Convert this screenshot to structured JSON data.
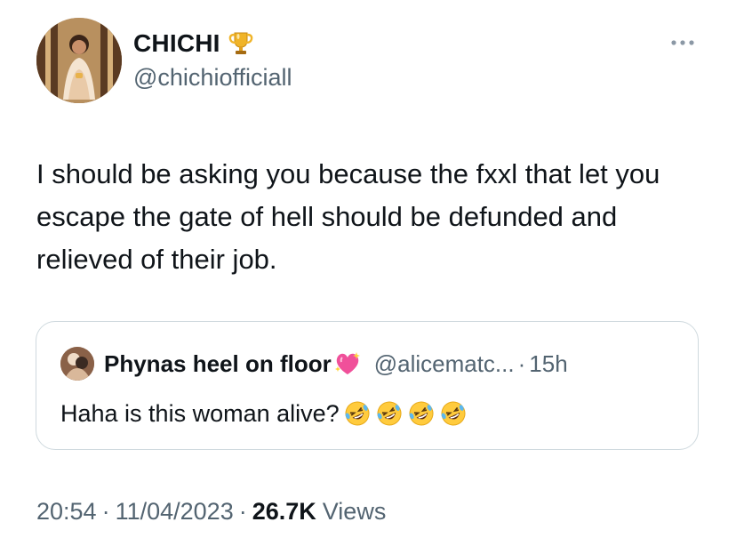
{
  "author": {
    "display_name": "CHICHI",
    "badge_icon": "trophy-icon",
    "handle": "@chichiofficiall"
  },
  "tweet": {
    "text": "I should be asking you because the fxxl that let you escape the gate of hell should be defunded and relieved of their job."
  },
  "quoted_tweet": {
    "display_name": "Phynas heel on floor",
    "name_emoji": "sparkling-heart-icon",
    "handle": "@alicematc...",
    "separator": "·",
    "time": "15h",
    "text": "Haha is this woman alive?",
    "emojis": [
      "rolling-laughing-icon",
      "rolling-laughing-icon",
      "rolling-laughing-icon",
      "rolling-laughing-icon"
    ]
  },
  "meta": {
    "time": "20:54",
    "separator": "·",
    "date": "11/04/2023",
    "views_count": "26.7K",
    "views_label": "Views"
  },
  "colors": {
    "text_primary": "#0f1419",
    "text_secondary": "#536471",
    "border": "#cfd9de",
    "background": "#ffffff"
  }
}
